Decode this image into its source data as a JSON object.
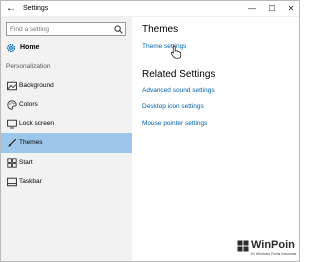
{
  "window": {
    "title": "Settings",
    "controls": {
      "minimize": "—",
      "maximize": "☐",
      "close": "✕"
    },
    "back_glyph": "←"
  },
  "sidebar": {
    "search": {
      "placeholder": "Find a setting",
      "icon": "search-icon"
    },
    "home": {
      "label": "Home",
      "icon": "gear-icon"
    },
    "section": "Personalization",
    "items": [
      {
        "label": "Background",
        "icon": "image-icon",
        "selected": false
      },
      {
        "label": "Colors",
        "icon": "palette-icon",
        "selected": false
      },
      {
        "label": "Lock screen",
        "icon": "monitor-icon",
        "selected": false
      },
      {
        "label": "Themes",
        "icon": "brush-icon",
        "selected": true
      },
      {
        "label": "Start",
        "icon": "start-grid-icon",
        "selected": false
      },
      {
        "label": "Taskbar",
        "icon": "taskbar-icon",
        "selected": false
      }
    ]
  },
  "content": {
    "title": "Themes",
    "theme_settings_link": "Theme settings",
    "related_title": "Related Settings",
    "related_links": [
      "Advanced sound settings",
      "Desktop icon settings",
      "Mouse pointer settings"
    ]
  },
  "watermark": {
    "name": "WinPoin",
    "tagline": "#1 Windows Portal Indonesia"
  },
  "colors": {
    "accent_link": "#0063b1",
    "selected_bg": "#9cc7ea",
    "sidebar_bg": "#f2f2f2"
  }
}
